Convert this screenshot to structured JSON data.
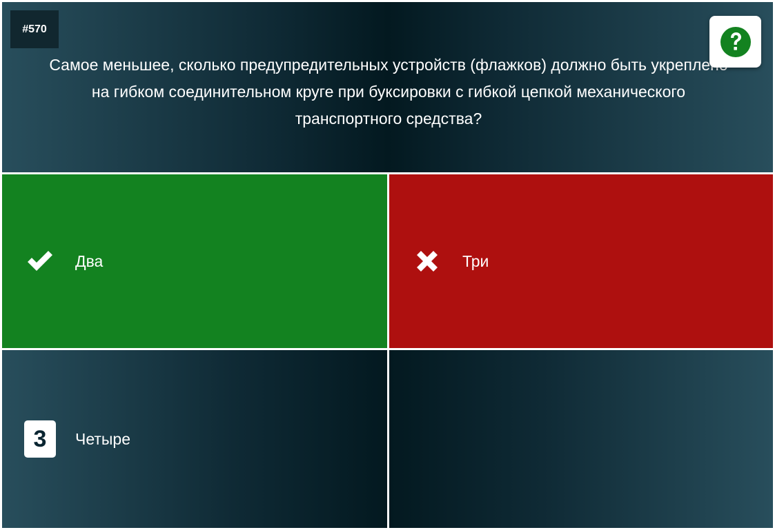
{
  "question": {
    "number": "#570",
    "text": "Самое меньшее, сколько предупредительных устройств (флажков) должно быть укреплено на гибком соединительном круге при буксировки с гибкой цепкой механического транспортного средства?"
  },
  "help": {
    "icon": "question-circle-icon",
    "color": "#138220"
  },
  "answers": [
    {
      "label": "Два",
      "state": "correct",
      "icon": "check-icon",
      "color": "#138220"
    },
    {
      "label": "Три",
      "state": "wrong",
      "icon": "cross-icon",
      "color": "#ae100f"
    },
    {
      "label": "Четыре",
      "state": "unanswered",
      "badge": "3"
    }
  ]
}
